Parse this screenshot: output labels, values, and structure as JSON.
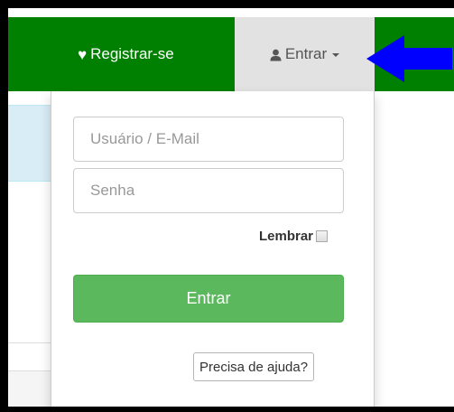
{
  "navbar": {
    "register_label": "Registrar-se",
    "login_label": "Entrar",
    "brand_color": "#008000",
    "register_icon": "heart-icon",
    "login_icon": "user-icon"
  },
  "annotation": {
    "arrow_icon": "arrow-left-icon",
    "arrow_color": "#0000ff"
  },
  "login_form": {
    "username_placeholder": "Usuário / E-Mail",
    "password_placeholder": "Senha",
    "remember_label": "Lembrar",
    "submit_label": "Entrar",
    "submit_color": "#5cb85c",
    "help_label": "Precisa de ajuda?"
  }
}
